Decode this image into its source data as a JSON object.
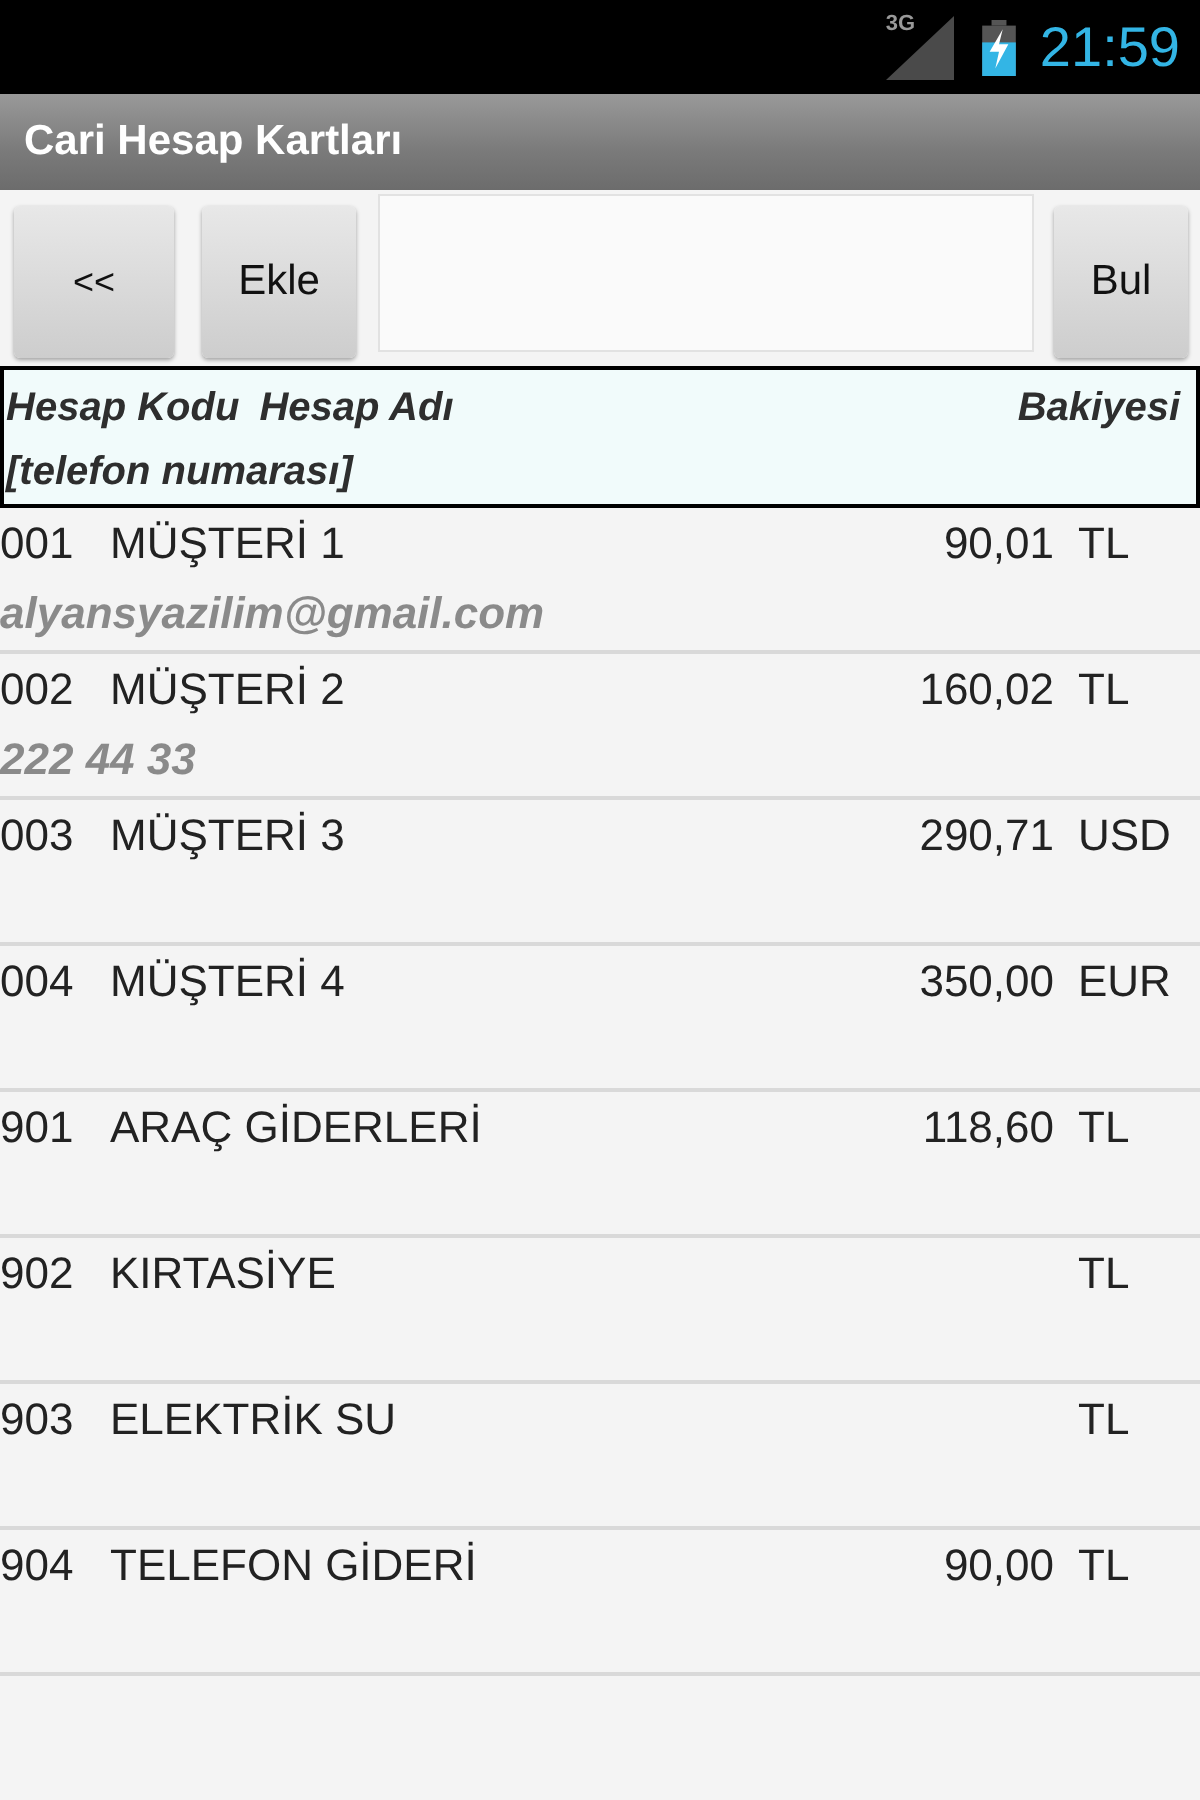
{
  "status_bar": {
    "network": "3G",
    "time": "21:59"
  },
  "window": {
    "title": "Cari Hesap Kartları"
  },
  "toolbar": {
    "buttons": [
      {
        "label": "<<"
      },
      {
        "label": "Ekle"
      }
    ],
    "search_button": "Bul"
  },
  "table": {
    "columns": [
      "Hesap Kodu",
      "Hesap Adı",
      "Bakiyesi"
    ],
    "subheader": "[telefon numarası]",
    "rows": [
      {
        "code": "001",
        "name": "MÜŞTERİ 1",
        "balance": "90,01",
        "currency": "TL",
        "detail": "alyansyazilim@gmail.com"
      },
      {
        "code": "002",
        "name": "MÜŞTERİ 2",
        "balance": "160,02",
        "currency": "TL",
        "detail": "222 44 33"
      },
      {
        "code": "003",
        "name": "MÜŞTERİ 3",
        "balance": "290,71",
        "currency": "USD"
      },
      {
        "code": "004",
        "name": "MÜŞTERİ 4",
        "balance": "350,00",
        "currency": "EUR"
      },
      {
        "code": "901",
        "name": "ARAÇ GİDERLERİ",
        "balance": "118,60",
        "currency": "TL"
      },
      {
        "code": "902",
        "name": "KIRTASİYE",
        "currency": "TL"
      },
      {
        "code": "903",
        "name": "ELEKTRİK SU",
        "currency": "TL"
      },
      {
        "code": "904",
        "name": "TELEFON GİDERİ",
        "balance": "90,00",
        "currency": "TL"
      }
    ]
  }
}
